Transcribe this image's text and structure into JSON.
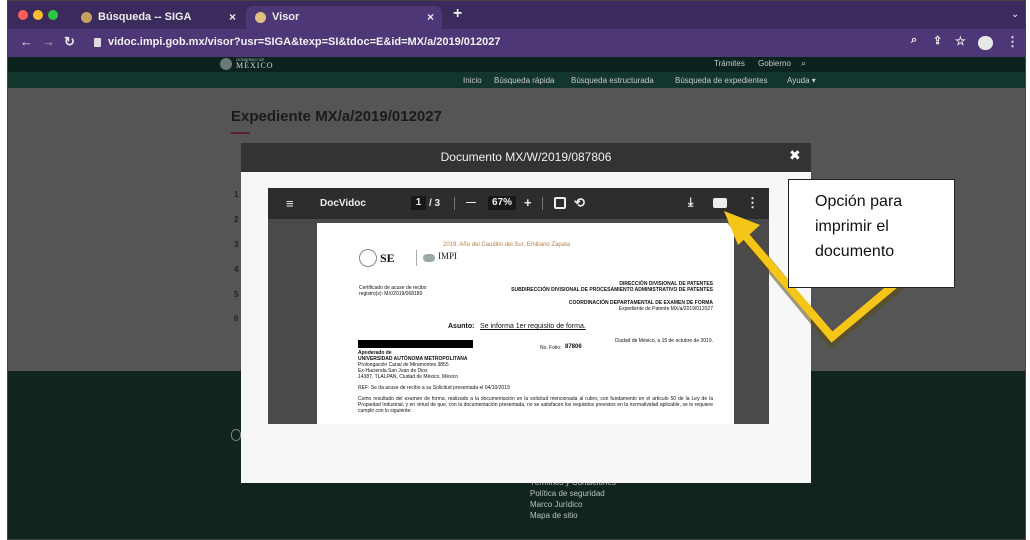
{
  "browser": {
    "tabs": [
      {
        "label": "Búsqueda -- SIGA",
        "close": "×"
      },
      {
        "label": "Visor",
        "close": "×"
      }
    ],
    "new_tab": "+",
    "url": "vidoc.impi.gob.mx/visor?usr=SIGA&texp=SI&tdoc=E&id=MX/a/2019/012027"
  },
  "site": {
    "logo_small": "GOBIERNO DE",
    "logo": "MÉXICO",
    "top_links": [
      "Trámites",
      "Gobierno"
    ],
    "nav": [
      "Inicio",
      "Búsqueda rápida",
      "Búsqueda estructurada",
      "Búsqueda de expedientes",
      "Ayuda ▾"
    ],
    "page_title": "Expediente MX/a/2019/012027",
    "row_numbers": [
      "1",
      "2",
      "3",
      "4",
      "5",
      "6"
    ],
    "footer_links": [
      "Términos y Condiciones",
      "Política de seguridad",
      "Marco Jurídico",
      "Mapa de sitio"
    ]
  },
  "modal": {
    "title": "Documento MX/W/2019/087806",
    "close": "✖"
  },
  "viewer": {
    "app_name": "DocVidoc",
    "page_current": "1",
    "page_total": "/ 3",
    "zoom": "67%",
    "minus": "—",
    "plus": "+"
  },
  "document": {
    "year_motto": "2019. Año del Caudillo del Sur, Emiliano Zapata",
    "se_logo": "SE",
    "impi_logo": "IMPI",
    "ack_label": "Certificado de acuse de recibo registro(s): MX/2019/068180",
    "direccion": "DIRECCIÓN DIVISIONAL DE PATENTES",
    "subdireccion": "SUBDIRECCIÓN DIVISIONAL DE PROCESAMIENTO ADMINISTRATIVO DE PATENTES",
    "coordinacion": "COORDINACIÓN DEPARTAMENTAL DE EXAMEN DE FORMA",
    "expediente": "Expediente de Patente MX/a/2019/012027",
    "asunto_label": "Asunto:",
    "asunto": "Se informa 1er requisito de forma.",
    "fecha": "Ciudad de México, a 15 de octubre de 2019.",
    "folio_label": "No. Folio:",
    "folio": "87806",
    "apoderado": "Apoderado de",
    "universidad": "UNIVERSIDAD AUTÓNOMA METROPOLITANA",
    "address1": "Prolongación Canal de Miramontes 3855",
    "address2": "Ex-Hacienda San Juan de Dios",
    "address3": "14387, TLALPAN, Ciudad de México, México",
    "ref": "REF: Se da acuse de recibo a su Solicitud presentada el 04/10/2019",
    "body": "Como resultado del examen de forma, realizado a la documentación en la solicitud mencionada al rubro, con fundamento en el artículo 50 de la Ley de la Propiedad Industrial, y en virtud de que, con la documentación presentada, no se satisfacen los requisitos previstos en la normatividad aplicable, se le requiere cumplir con lo siguiente:"
  },
  "callout": {
    "text": "Opción para imprimir el documento"
  },
  "colors": {
    "tabbar": "#3b2a5c",
    "addrbar": "#4d3777",
    "arrow": "#f5c518",
    "site_header": "#0b231e",
    "accent": "#9b2247"
  }
}
